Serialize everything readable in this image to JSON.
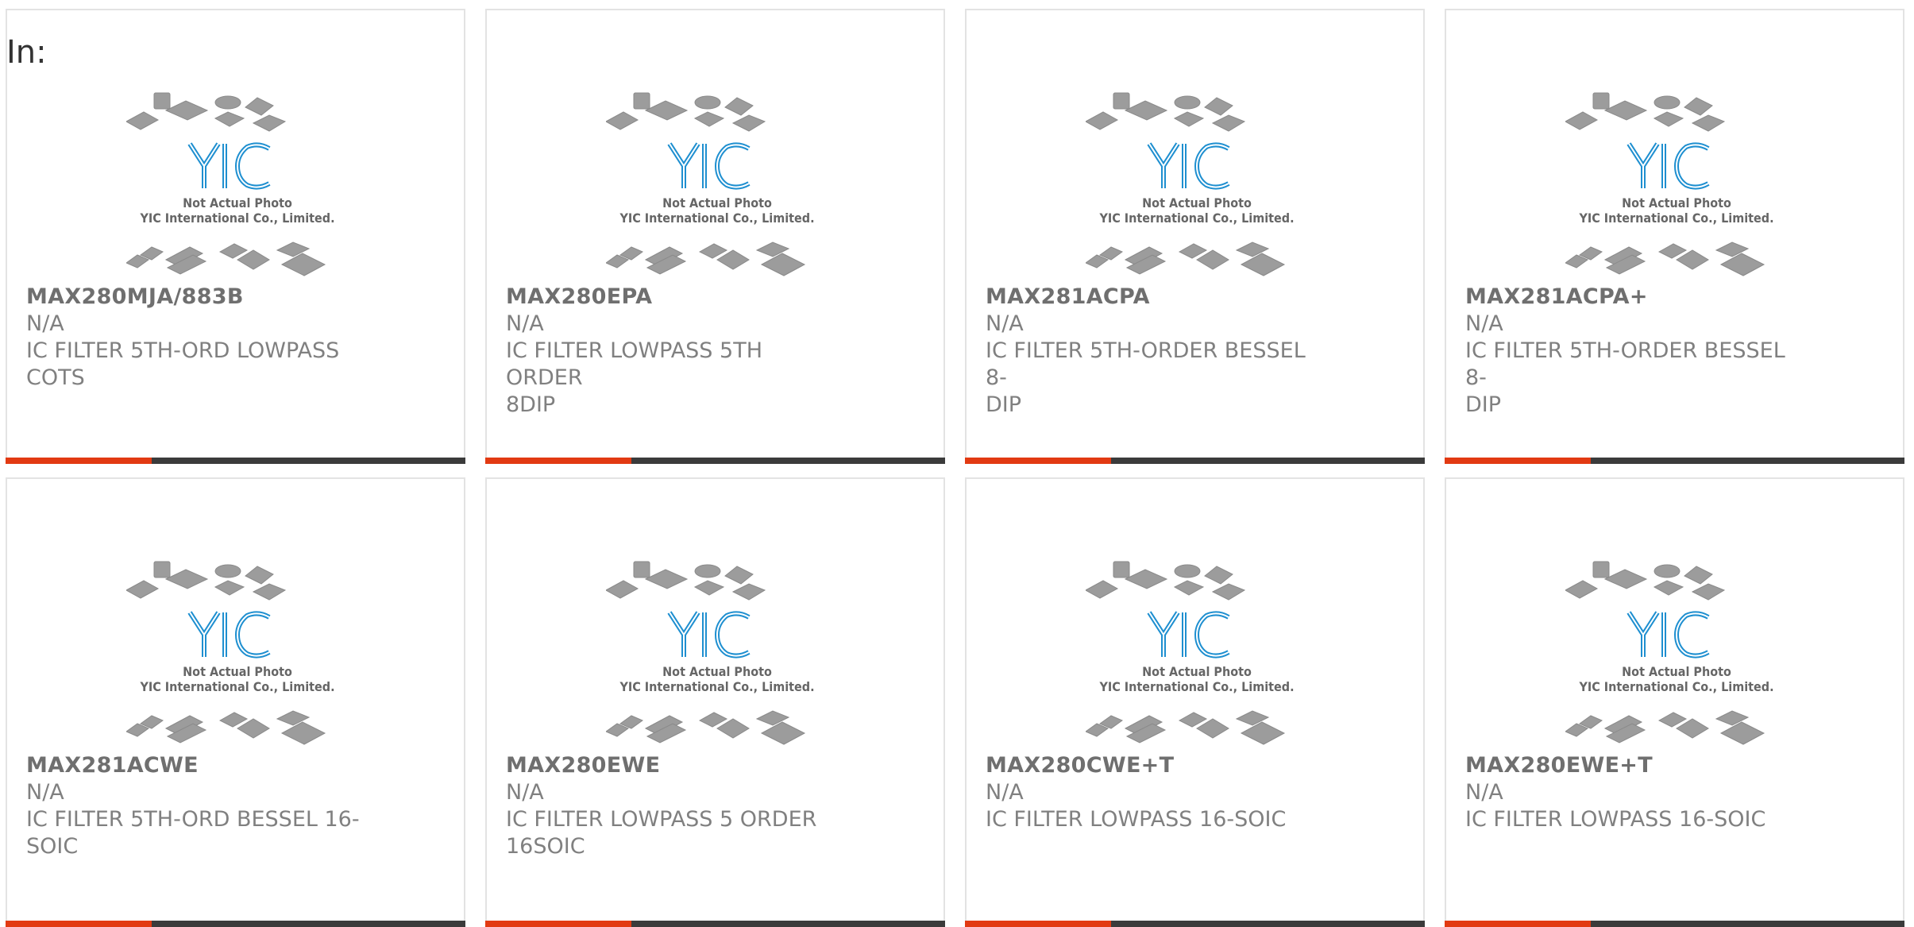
{
  "heading": "In:",
  "placeholder": {
    "logo": "YIC",
    "line1": "Not Actual Photo",
    "line2": "YIC International Co., Limited."
  },
  "colors": {
    "accent": "#e23a12",
    "bar": "#3b3b3b",
    "logo_blue": "#1e8fd0"
  },
  "products": [
    {
      "part": "MAX280MJA/883B",
      "manufacturer": "N/A",
      "description": [
        "IC FILTER 5TH-ORD LOWPASS",
        "COTS"
      ]
    },
    {
      "part": "MAX280EPA",
      "manufacturer": "N/A",
      "description": [
        "IC FILTER LOWPASS 5TH ORDER",
        "8DIP"
      ]
    },
    {
      "part": "MAX281ACPA",
      "manufacturer": "N/A",
      "description": [
        "IC FILTER 5TH-ORDER BESSEL 8-",
        "DIP"
      ]
    },
    {
      "part": "MAX281ACPA+",
      "manufacturer": "N/A",
      "description": [
        "IC FILTER 5TH-ORDER BESSEL 8-",
        "DIP"
      ]
    },
    {
      "part": "MAX281ACWE",
      "manufacturer": "N/A",
      "description": [
        "IC FILTER 5TH-ORD BESSEL 16-",
        "SOIC"
      ]
    },
    {
      "part": "MAX280EWE",
      "manufacturer": "N/A",
      "description": [
        "IC FILTER LOWPASS 5 ORDER",
        "16SOIC"
      ]
    },
    {
      "part": "MAX280CWE+T",
      "manufacturer": "N/A",
      "description": [
        "IC FILTER LOWPASS 16-SOIC",
        ""
      ]
    },
    {
      "part": "MAX280EWE+T",
      "manufacturer": "N/A",
      "description": [
        "IC FILTER LOWPASS 16-SOIC",
        ""
      ]
    }
  ]
}
